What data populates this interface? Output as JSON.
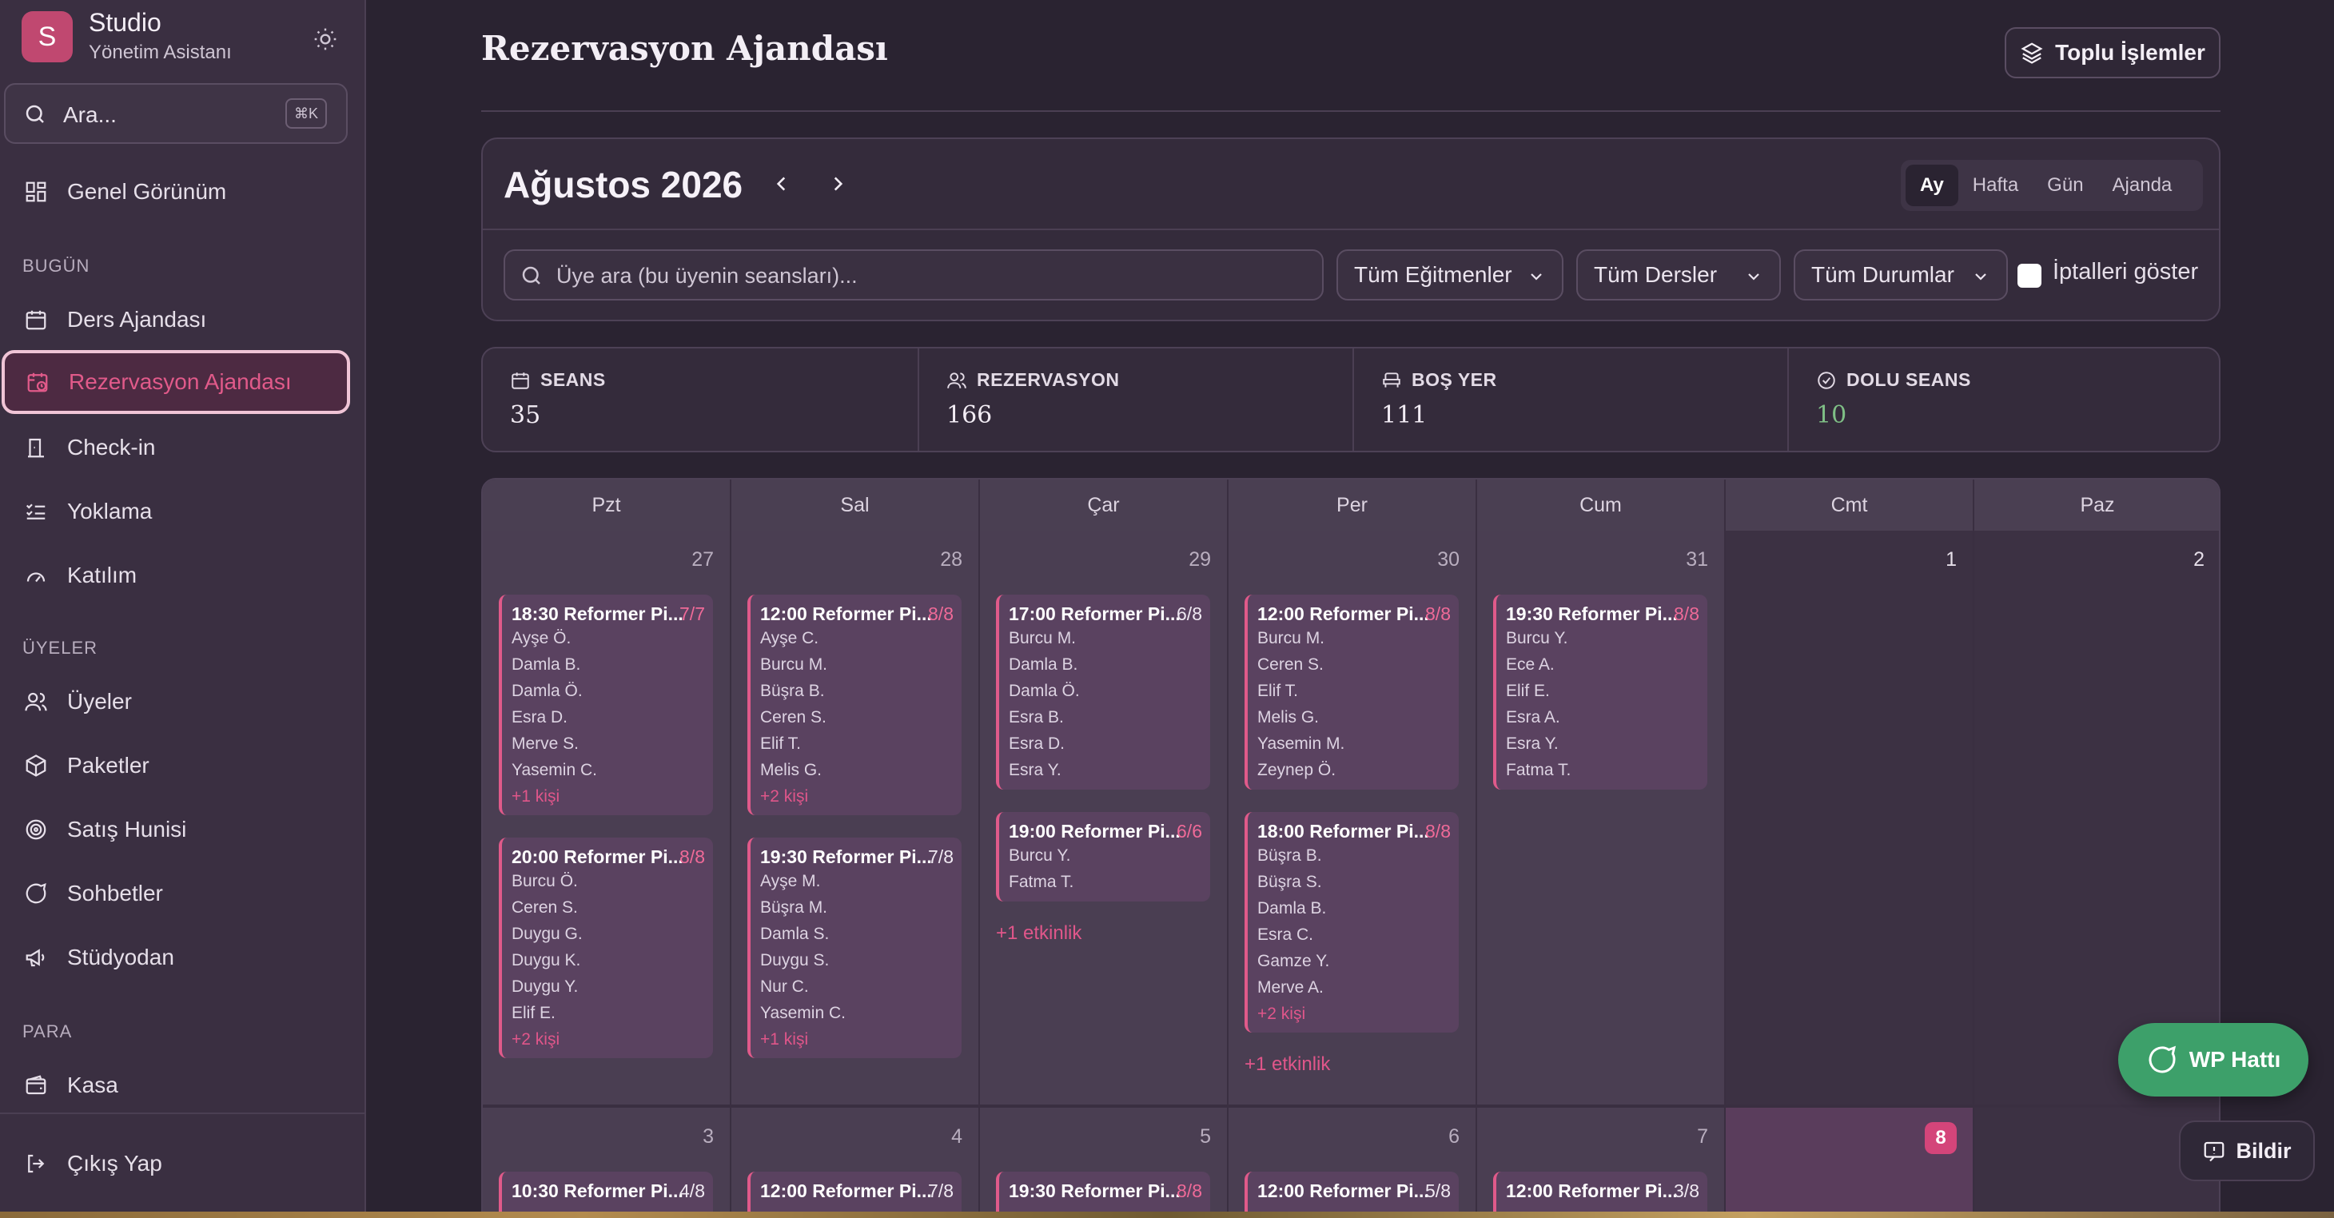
{
  "brand": {
    "initial": "S",
    "name": "Studio",
    "subtitle": "Yönetim Asistanı"
  },
  "search": {
    "placeholder": "Ara...",
    "shortcut": "⌘K"
  },
  "nav": {
    "overview": "Genel Görünüm",
    "section_today": "BUGÜN",
    "ders_ajandasi": "Ders Ajandası",
    "rezervasyon_ajandasi": "Rezervasyon Ajandası",
    "checkin": "Check-in",
    "yoklama": "Yoklama",
    "katilim": "Katılım",
    "section_members": "ÜYELER",
    "uyeler": "Üyeler",
    "paketler": "Paketler",
    "satis_hunisi": "Satış Hunisi",
    "sohbetler": "Sohbetler",
    "studyodan": "Stüdyodan",
    "section_money": "PARA",
    "kasa": "Kasa",
    "logout": "Çıkış Yap"
  },
  "page": {
    "title": "Rezervasyon Ajandası",
    "bulk_button": "Toplu İşlemler"
  },
  "calendar": {
    "month_label": "Ağustos 2026",
    "views": [
      "Ay",
      "Hafta",
      "Gün",
      "Ajanda"
    ],
    "active_view": "Ay",
    "member_search_placeholder": "Üye ara (bu üyenin seansları)...",
    "filters": {
      "instructor": "Tüm Eğitmenler",
      "course": "Tüm Dersler",
      "status": "Tüm Durumlar",
      "show_cancelled": "İptalleri göster",
      "show_cancelled_checked": false
    },
    "weekdays": [
      "Pzt",
      "Sal",
      "Çar",
      "Per",
      "Cum",
      "Cmt",
      "Paz"
    ],
    "week1": {
      "days": [
        "27",
        "28",
        "29",
        "30",
        "31",
        "1",
        "2"
      ],
      "d0e0": {
        "time": "18:30 Reformer Pi...",
        "cap": "7/7",
        "m": [
          "Ayşe Ö.",
          "Damla B.",
          "Damla Ö.",
          "Esra D.",
          "Merve S.",
          "Yasemin C."
        ],
        "more": "+1 kişi"
      },
      "d0e1": {
        "time": "20:00 Reformer Pi...",
        "cap": "8/8",
        "m": [
          "Burcu Ö.",
          "Ceren S.",
          "Duygu G.",
          "Duygu K.",
          "Duygu Y.",
          "Elif E."
        ],
        "more": "+2 kişi"
      },
      "d1e0": {
        "time": "12:00 Reformer Pi...",
        "cap": "8/8",
        "m": [
          "Ayşe C.",
          "Burcu M.",
          "Büşra B.",
          "Ceren S.",
          "Elif T.",
          "Melis G."
        ],
        "more": "+2 kişi"
      },
      "d1e1": {
        "time": "19:30 Reformer Pi...",
        "cap": "7/8",
        "m": [
          "Ayşe M.",
          "Büşra M.",
          "Damla S.",
          "Duygu S.",
          "Nur C.",
          "Yasemin C."
        ],
        "more": "+1 kişi"
      },
      "d2e0": {
        "time": "17:00 Reformer Pi...",
        "cap": "6/8",
        "m": [
          "Burcu M.",
          "Damla B.",
          "Damla Ö.",
          "Esra B.",
          "Esra D.",
          "Esra Y."
        ]
      },
      "d2e1": {
        "time": "19:00 Reformer Pi...",
        "cap": "6/6",
        "m": [
          "Burcu Y.",
          "Fatma T."
        ]
      },
      "d2_more": "+1 etkinlik",
      "d3e0": {
        "time": "12:00 Reformer Pi...",
        "cap": "8/8",
        "m": [
          "Burcu M.",
          "Ceren S.",
          "Elif T.",
          "Melis G.",
          "Yasemin M.",
          "Zeynep Ö."
        ]
      },
      "d3e1": {
        "time": "18:00 Reformer Pi...",
        "cap": "8/8",
        "m": [
          "Büşra B.",
          "Büşra S.",
          "Damla B.",
          "Esra C.",
          "Gamze Y.",
          "Merve A."
        ],
        "more": "+2 kişi"
      },
      "d3_more": "+1 etkinlik",
      "d4e0": {
        "time": "19:30 Reformer Pi...",
        "cap": "8/8",
        "m": [
          "Burcu Y.",
          "Ece A.",
          "Elif E.",
          "Esra A.",
          "Esra Y.",
          "Fatma T."
        ]
      }
    },
    "week2": {
      "days": [
        "3",
        "4",
        "5",
        "6",
        "7",
        "8",
        ""
      ],
      "today": "8",
      "events": [
        {
          "time": "10:30 Reformer Pi...",
          "cap": "4/8"
        },
        {
          "time": "12:00 Reformer Pi...",
          "cap": "7/8"
        },
        {
          "time": "19:30 Reformer Pi...",
          "cap": "8/8"
        },
        {
          "time": "12:00 Reformer Pi...",
          "cap": "5/8"
        },
        {
          "time": "12:00 Reformer Pi...",
          "cap": "3/8"
        }
      ]
    }
  },
  "stats": [
    {
      "label": "SEANS",
      "value": "35",
      "icon": "calendar-icon"
    },
    {
      "label": "REZERVASYON",
      "value": "166",
      "icon": "users-icon"
    },
    {
      "label": "BOŞ YER",
      "value": "111",
      "icon": "seat-icon"
    },
    {
      "label": "DOLU SEANS",
      "value": "10",
      "icon": "check-circle-icon"
    }
  ],
  "colors": {
    "accent": "#e0568a",
    "full_capacity": "#ef6a98",
    "success": "#7fbf86",
    "whatsapp": "#3da06a"
  },
  "floating": {
    "whatsapp": "WP Hattı",
    "report": "Bildir"
  }
}
